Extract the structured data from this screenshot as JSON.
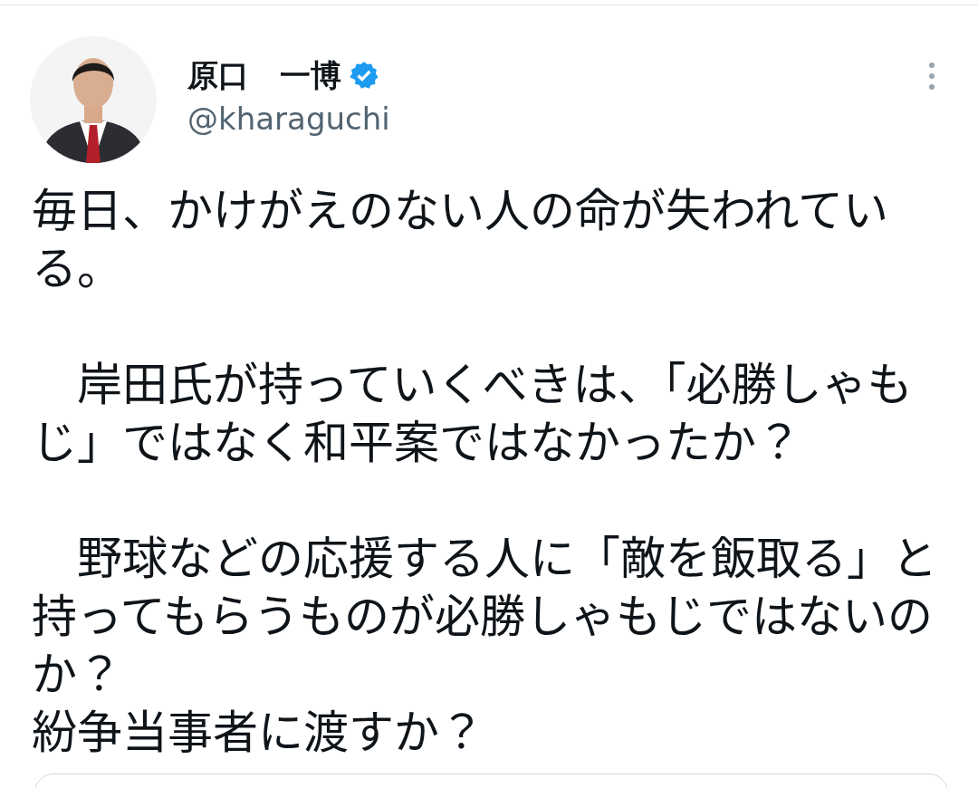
{
  "tweet": {
    "author": {
      "name": "原口　一博",
      "verified": true,
      "handle": "@kharaguchi"
    },
    "paragraphs": [
      [
        "毎日、かけがえのない人の命が失われている。"
      ],
      [
        "　岸田氏が持っていくべきは、「必勝しゃもじ」ではなく和平案ではなかったか？"
      ],
      [
        "　野球などの応援する人に「敵を飯取る」と持ってもらうものが必勝しゃもじではないのか？",
        "紛争当事者に渡すか？"
      ]
    ]
  }
}
